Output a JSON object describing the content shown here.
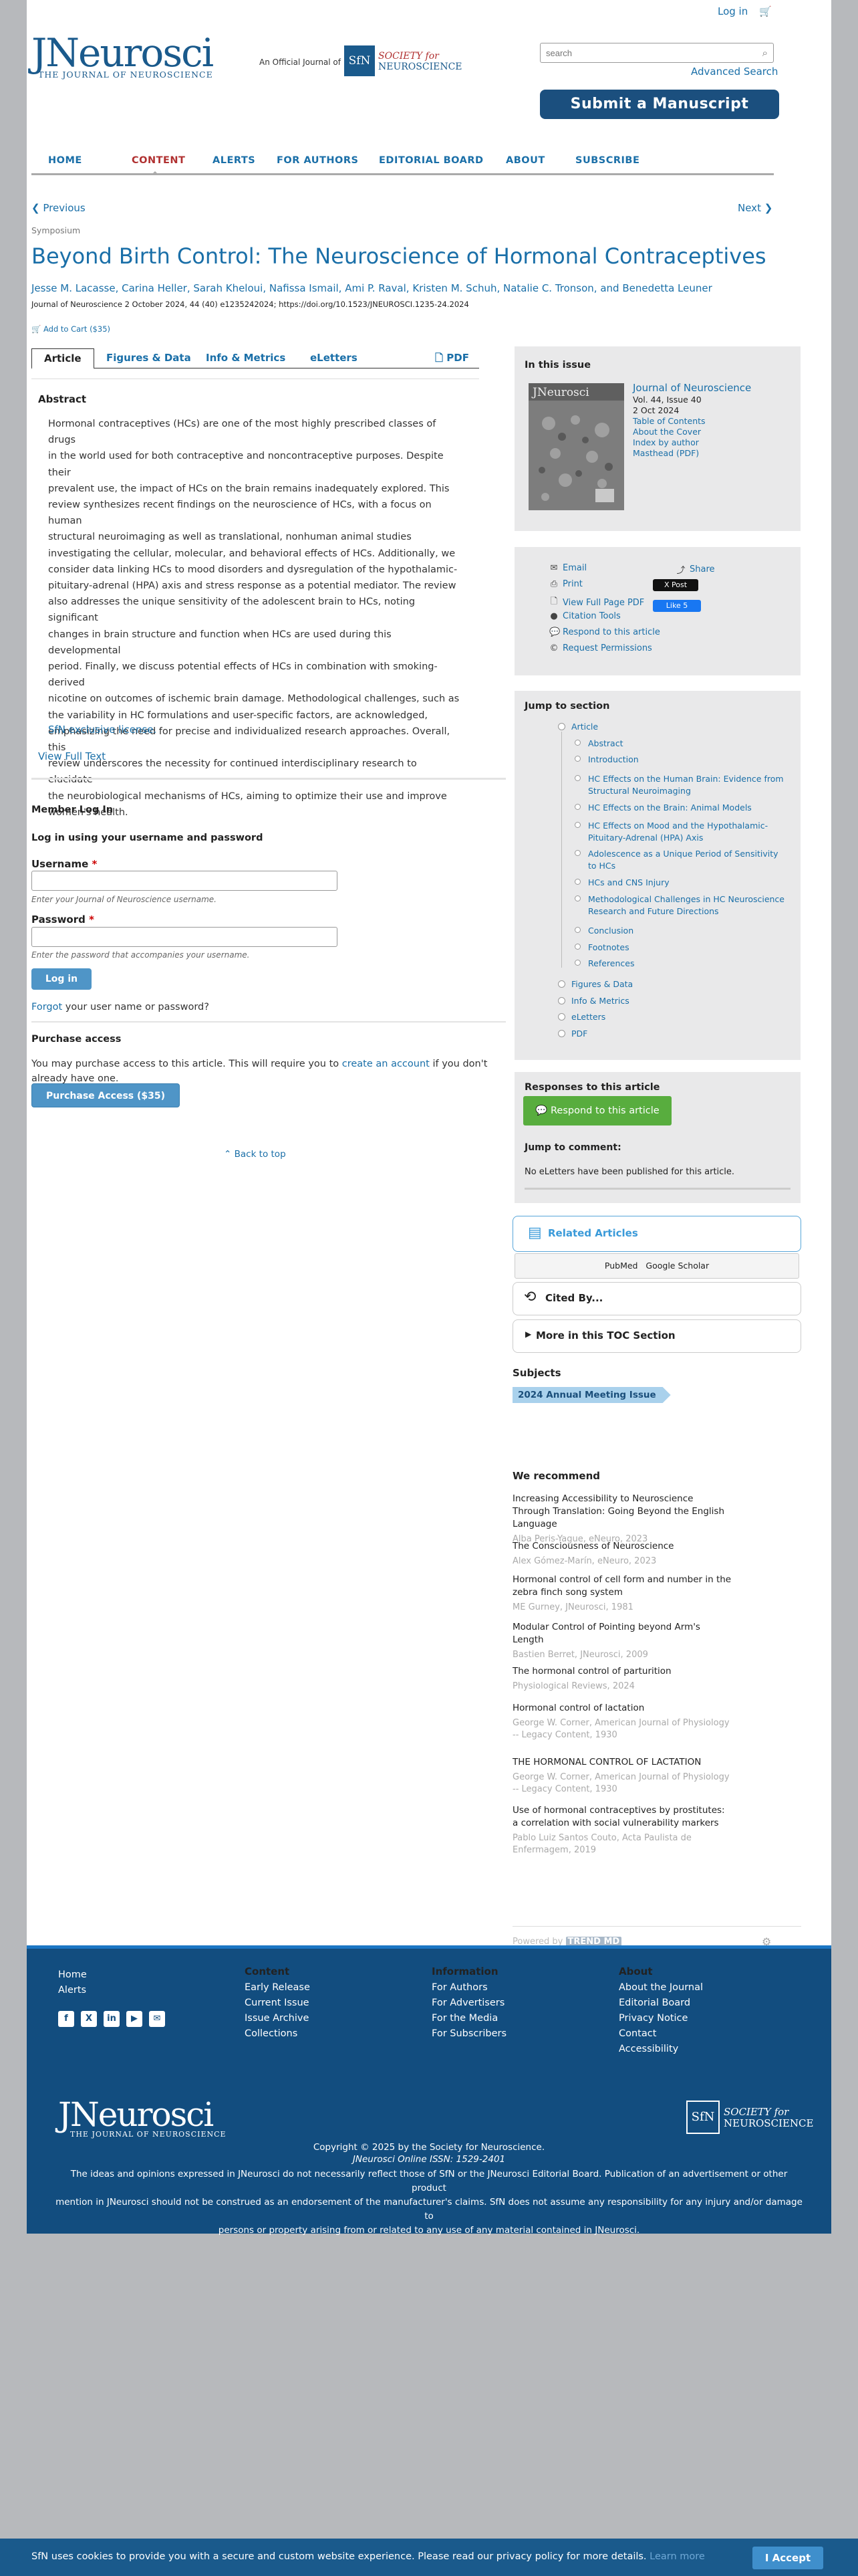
{
  "header": {
    "login": "Log in",
    "cart_icon": "cart-icon",
    "logo_main": "JNeurosci",
    "logo_sub": "THE JOURNAL OF NEUROSCIENCE",
    "official": "An Official Journal of",
    "sfn_badge": "SfN",
    "sfn_line1": "SOCIETY for",
    "sfn_line2": "NEUROSCIENCE",
    "search_placeholder": "search",
    "advanced_search": "Advanced Search",
    "submit": "Submit a Manuscript"
  },
  "nav": [
    "HOME",
    "CONTENT",
    "ALERTS",
    "FOR AUTHORS",
    "EDITORIAL BOARD",
    "ABOUT",
    "SUBSCRIBE"
  ],
  "nav_active": "CONTENT",
  "article": {
    "previous": "Previous",
    "next": "Next",
    "section": "Symposium",
    "title": "Beyond Birth Control: The Neuroscience of Hormonal Contraceptives",
    "authors": "Jesse M. Lacasse, Carina Heller, Sarah Kheloui, Nafissa Ismail, Ami P. Raval, Kristen M. Schuh, Natalie C. Tronson, and Benedetta Leuner",
    "citation": "Journal of Neuroscience 2 October 2024, 44 (40) e1235242024; https://doi.org/10.1523/JNEUROSCI.1235-24.2024",
    "add_to_cart": "Add to Cart ($35)",
    "tabs": [
      "Article",
      "Figures & Data",
      "Info & Metrics",
      "eLetters",
      "PDF"
    ],
    "abstract_heading": "Abstract",
    "abstract_lines": [
      "Hormonal contraceptives (HCs) are one of the most highly prescribed classes of drugs",
      "in the world used for both contraceptive and noncontraceptive purposes. Despite their",
      "prevalent use, the impact of HCs on the brain remains inadequately explored. This",
      "review synthesizes recent findings on the neuroscience of HCs, with a focus on human",
      "structural neuroimaging as well as translational, nonhuman animal studies",
      "investigating the cellular, molecular, and behavioral effects of HCs. Additionally, we",
      "consider data linking HCs to mood disorders and dysregulation of the hypothalamic-",
      "pituitary-adrenal (HPA) axis and stress response as a potential mediator. The review",
      "also addresses the unique sensitivity of the adolescent brain to HCs, noting significant",
      "changes in brain structure and function when HCs are used during this developmental",
      "period. Finally, we discuss potential effects of HCs in combination with smoking-derived",
      "nicotine on outcomes of ischemic brain damage. Methodological challenges, such as",
      "the variability in HC formulations and user-specific factors, are acknowledged,",
      "emphasizing the need for precise and individualized research approaches. Overall, this",
      "review underscores the necessity for continued interdisciplinary research to elucidate",
      "the neurobiological mechanisms of HCs, aiming to optimize their use and improve",
      "women's health."
    ],
    "license": "SfN exclusive license.",
    "view_full_text": "View Full Text"
  },
  "login": {
    "title": "Member Log In",
    "subtitle": "Log in using your username and password",
    "username_label": "Username",
    "username_hint": "Enter your Journal of Neuroscience username.",
    "password_label": "Password",
    "password_hint": "Enter the password that accompanies your username.",
    "required_mark": "*",
    "button": "Log in",
    "forgot_link": "Forgot",
    "forgot_rest": " your user name or password?"
  },
  "purchase": {
    "title": "Purchase access",
    "text_before": "You may purchase access to this article. This will require you to ",
    "link": "create an account",
    "text_after": " if you don't",
    "text_line2": "already have one.",
    "button": "Purchase Access ($35)",
    "back_to_top": "Back to top"
  },
  "issue": {
    "heading": "In this issue",
    "journal": "Journal of Neuroscience",
    "vol": "Vol. 44, Issue 40",
    "date": "2 Oct 2024",
    "links": [
      "Table of Contents",
      "About the Cover",
      "Index by author",
      "Masthead (PDF)"
    ],
    "cover_title": "JNeurosci"
  },
  "tools": {
    "left": [
      "Email",
      "Print",
      "View Full Page PDF",
      "Citation Tools",
      "Respond to this article",
      "Request Permissions"
    ],
    "share": "Share",
    "xpost": "X Post",
    "fblike": "Like 5"
  },
  "jump": {
    "heading": "Jump to section",
    "article": "Article",
    "sub": [
      "Abstract",
      "Introduction",
      "HC Effects on the Human Brain: Evidence from Structural Neuroimaging",
      "HC Effects on the Brain: Animal Models",
      "HC Effects on Mood and the Hypothalamic-Pituitary-Adrenal (HPA) Axis",
      "Adolescence as a Unique Period of Sensitivity to HCs",
      "HCs and CNS Injury",
      "Methodological Challenges in HC Neuroscience Research and Future Directions",
      "Conclusion",
      "Footnotes",
      "References"
    ],
    "top": [
      "Figures & Data",
      "Info & Metrics",
      "eLetters",
      "PDF"
    ]
  },
  "responses": {
    "heading": "Responses to this article",
    "button": "Respond to this article",
    "jump_heading": "Jump to comment:",
    "none": "No eLetters have been published for this article."
  },
  "related": {
    "heading": "Related Articles",
    "pubmed": "PubMed",
    "scholar": "Google Scholar",
    "cited": "Cited By...",
    "toc": "More in this TOC Section"
  },
  "subjects": {
    "heading": "Subjects",
    "tag": "2024 Annual Meeting Issue"
  },
  "recommend": {
    "heading": "We recommend",
    "items": [
      {
        "title": "Increasing Accessibility to Neuroscience Through Translation: Going Beyond the English Language",
        "meta": "Alba Peris-Yague, eNeuro, 2023"
      },
      {
        "title": "The Consciousness of Neuroscience",
        "meta": "Alex Gómez-Marín, eNeuro, 2023"
      },
      {
        "title": "Hormonal control of cell form and number in the zebra finch song system",
        "meta": "ME Gurney, JNeurosci, 1981"
      },
      {
        "title": "Modular Control of Pointing beyond Arm's Length",
        "meta": "Bastien Berret, JNeurosci, 2009"
      },
      {
        "title": "The hormonal control of parturition",
        "meta": "Physiological Reviews, 2024"
      },
      {
        "title": "Hormonal control of lactation",
        "meta": "George W. Corner, American Journal of Physiology -- Legacy Content, 1930"
      },
      {
        "title": "THE HORMONAL CONTROL OF LACTATION",
        "meta": "George W. Corner, American Journal of Physiology -- Legacy Content, 1930"
      },
      {
        "title": "Use of hormonal contraceptives by prostitutes: a correlation with social vulnerability markers",
        "meta": "Pablo Luiz Santos Couto, Acta Paulista de Enfermagem, 2019"
      }
    ],
    "powered": "Powered by",
    "trendmd": "TREND MD"
  },
  "footer": {
    "col1": [
      "Home",
      "Alerts"
    ],
    "content_head": "Content",
    "content": [
      "Early Release",
      "Current Issue",
      "Issue Archive",
      "Collections"
    ],
    "info_head": "Information",
    "info": [
      "For Authors",
      "For Advertisers",
      "For the Media",
      "For Subscribers"
    ],
    "about_head": "About",
    "about": [
      "About the Journal",
      "Editorial Board",
      "Privacy Notice",
      "Contact",
      "Accessibility"
    ],
    "social": [
      "f",
      "X",
      "in",
      "▶",
      "✉"
    ],
    "logo_main": "JNeurosci",
    "logo_sub": "THE JOURNAL OF NEUROSCIENCE",
    "sfn_badge": "SfN",
    "sfn_line1": "SOCIETY for",
    "sfn_line2": "NEUROSCIENCE",
    "copyright": "Copyright © 2025 by the Society for Neuroscience.",
    "issn": "JNeurosci Online ISSN: 1529-2401",
    "disclaimer1": "The ideas and opinions expressed in JNeurosci do not necessarily reflect those of SfN or the JNeurosci Editorial Board. Publication of an advertisement or other product",
    "disclaimer2": "mention in JNeurosci should not be construed as an endorsement of the manufacturer's claims. SfN does not assume any responsibility for any injury and/or damage to",
    "disclaimer3": "persons or property arising from or related to any use of any material contained in JNeurosci."
  },
  "cookie": {
    "message": "SfN uses cookies to provide you with a secure and custom website experience. Please read our privacy policy for more details.",
    "learn": "Learn more",
    "button": "I Accept"
  }
}
